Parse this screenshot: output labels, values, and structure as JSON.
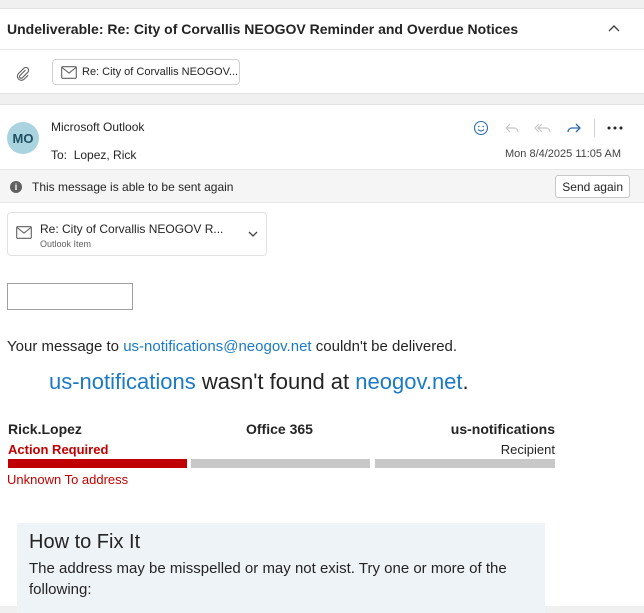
{
  "header": {
    "subject": "Undeliverable: Re: City of Corvallis NEOGOV Reminder and Overdue Notices",
    "attachment_chip": "Re: City of Corvallis NEOGOV..."
  },
  "message": {
    "avatar_initials": "MO",
    "sender": "Microsoft Outlook",
    "to_label": "To:",
    "to_value": "Lopez, Rick",
    "date": "Mon 8/4/2025 11:05 AM"
  },
  "info_bar": {
    "text": "This message is able to be sent again",
    "send_again": "Send again"
  },
  "attached_item": {
    "title": "Re: City of Corvallis NEOGOV R...",
    "subtitle": "Outlook Item"
  },
  "body": {
    "line1_prefix": "Your message to ",
    "line1_email": "us-notifications@neogov.net",
    "line1_suffix": " couldn't be delivered.",
    "headline_user": "us-notifications",
    "headline_middle": " wasn't found at ",
    "headline_domain": "neogov.net",
    "headline_end": "."
  },
  "delivery_flow": {
    "sender": "Rick.Lopez",
    "sender_status": "Action Required",
    "server": "Office 365",
    "recipient": "us-notifications",
    "recipient_role": "Recipient",
    "error": "Unknown To address"
  },
  "fix": {
    "title": "How to Fix It",
    "text": "The address may be misspelled or may not exist. Try one or more of the following:"
  },
  "colors": {
    "link": "#1b7ac6",
    "error_red": "#c00000",
    "avatar_bg": "#a9d3de"
  }
}
